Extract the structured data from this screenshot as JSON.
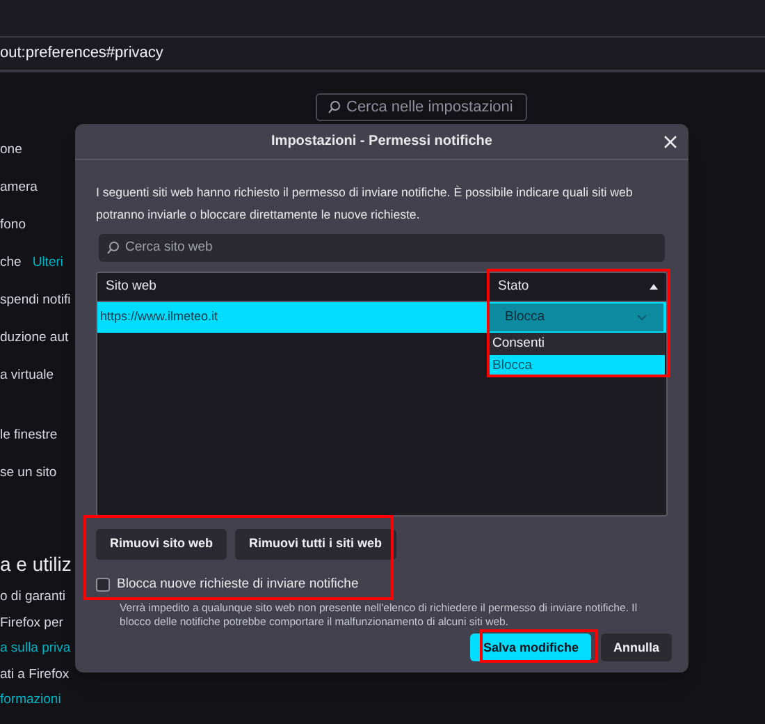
{
  "browser": {
    "url": "out:preferences#privacy"
  },
  "settings_search": {
    "placeholder": "Cerca nelle impostazioni"
  },
  "background_groups": [
    {
      "lines": [
        {
          "parts": [
            {
              "text": "one",
              "kind": "text"
            }
          ]
        },
        {
          "parts": [
            {
              "text": "amera",
              "kind": "text"
            }
          ]
        },
        {
          "parts": [
            {
              "text": "fono",
              "kind": "text"
            }
          ]
        },
        {
          "parts": [
            {
              "text": "che",
              "kind": "text"
            },
            {
              "text": "Ulteri",
              "kind": "link"
            }
          ]
        },
        {
          "parts": [
            {
              "text": "spendi notifi",
              "kind": "text"
            }
          ]
        },
        {
          "parts": [
            {
              "text": "duzione aut",
              "kind": "text"
            }
          ]
        },
        {
          "parts": [
            {
              "text": "a virtuale",
              "kind": "text"
            }
          ]
        }
      ]
    },
    {
      "lines": [
        {
          "parts": [
            {
              "text": "le finestre",
              "kind": "text"
            }
          ]
        },
        {
          "parts": [
            {
              "text": "se un sito",
              "kind": "text"
            }
          ]
        }
      ]
    },
    {
      "lines": [
        {
          "parts": [
            {
              "text": "a e utiliz",
              "kind": "heading"
            }
          ]
        },
        {
          "parts": [
            {
              "text": "o di garanti",
              "kind": "text"
            }
          ]
        },
        {
          "parts": [
            {
              "text": "Firefox per",
              "kind": "text"
            }
          ]
        },
        {
          "parts": [
            {
              "text": "a sulla priva",
              "kind": "link"
            }
          ]
        },
        {
          "parts": [
            {
              "text": "ati a Firefox",
              "kind": "text"
            }
          ]
        },
        {
          "parts": [
            {
              "text": "formazioni",
              "kind": "link"
            }
          ]
        }
      ]
    }
  ],
  "dialog": {
    "title": "Impostazioni - Permessi notifiche",
    "description": "I seguenti siti web hanno richiesto il permesso di inviare notifiche. È possibile indicare quali siti web potranno inviarle o bloccare direttamente le nuove richieste.",
    "search": {
      "placeholder": "Cerca sito web"
    },
    "columns": [
      "Sito web",
      "Stato"
    ],
    "rows": [
      {
        "site": "https://www.ilmeteo.it",
        "status": "Blocca",
        "selected": true
      }
    ],
    "dropdown_options": [
      {
        "label": "Consenti",
        "selected": false
      },
      {
        "label": "Blocca",
        "selected": true
      }
    ],
    "buttons": [
      "Rimuovi sito web",
      "Rimuovi tutti i siti web"
    ],
    "checkbox": {
      "label": "Blocca nuove richieste di inviare notifiche",
      "checked": false
    },
    "note": "Verrà impedito a qualunque sito web non presente nell'elenco di richiedere il permesso di inviare notifiche. Il blocco delle notifiche potrebbe comportare il malfunzionamento di alcuni siti web.",
    "footer_buttons": [
      {
        "label": "Salva modifiche",
        "kind": "primary"
      },
      {
        "label": "Annulla",
        "kind": "secondary"
      }
    ]
  }
}
